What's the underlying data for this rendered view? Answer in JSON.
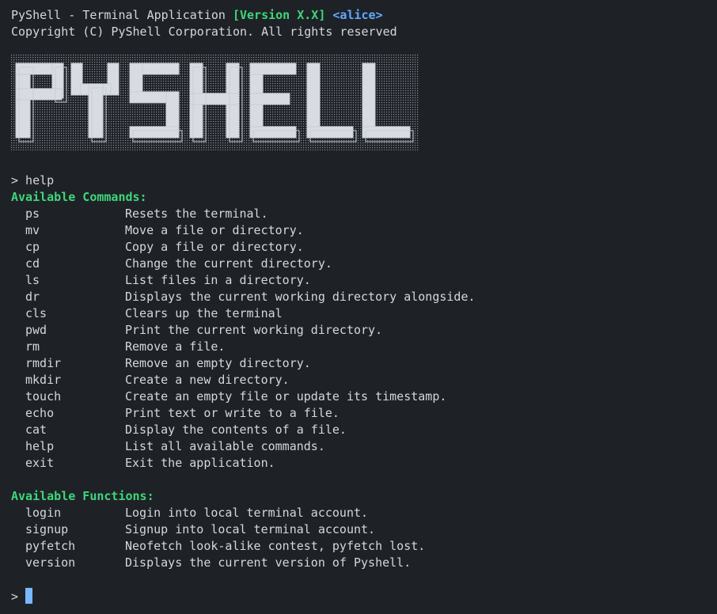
{
  "header": {
    "app_title": "PyShell - Terminal Application ",
    "version": "[Version X.X]",
    "user": "<alice>",
    "copyright": "Copyright (C) PyShell Corporation. All rights reserved"
  },
  "banner": {
    "text": "PYSHELL",
    "fill_color": "#d8dbe2",
    "outline_color": "#c8ccd4"
  },
  "session": {
    "prompt_symbol": ">",
    "entered_command": "> help"
  },
  "commands": {
    "heading": "Available Commands:",
    "items": [
      {
        "name": "ps",
        "desc": "Resets the terminal."
      },
      {
        "name": "mv",
        "desc": "Move a file or directory."
      },
      {
        "name": "cp",
        "desc": "Copy a file or directory."
      },
      {
        "name": "cd",
        "desc": "Change the current directory."
      },
      {
        "name": "ls",
        "desc": "List files in a directory."
      },
      {
        "name": "dr",
        "desc": "Displays the current working directory alongside."
      },
      {
        "name": "cls",
        "desc": "Clears up the terminal"
      },
      {
        "name": "pwd",
        "desc": "Print the current working directory."
      },
      {
        "name": "rm",
        "desc": "Remove a file."
      },
      {
        "name": "rmdir",
        "desc": "Remove an empty directory."
      },
      {
        "name": "mkdir",
        "desc": "Create a new directory."
      },
      {
        "name": "touch",
        "desc": "Create an empty file or update its timestamp."
      },
      {
        "name": "echo",
        "desc": "Print text or write to a file."
      },
      {
        "name": "cat",
        "desc": "Display the contents of a file."
      },
      {
        "name": "help",
        "desc": "List all available commands."
      },
      {
        "name": "exit",
        "desc": "Exit the application."
      }
    ]
  },
  "functions": {
    "heading": "Available Functions:",
    "items": [
      {
        "name": "login",
        "desc": "Login into local terminal account."
      },
      {
        "name": "signup",
        "desc": "Signup into local terminal account."
      },
      {
        "name": "pyfetch",
        "desc": "Neofetch look-alike contest, pyfetch lost."
      },
      {
        "name": "version",
        "desc": "Displays the current version of Pyshell."
      }
    ]
  },
  "colors": {
    "background": "#1e2227",
    "text": "#d4d7dd",
    "heading_green": "#3fd67a",
    "user_blue": "#62a8ff",
    "cursor": "#79b8ff"
  }
}
